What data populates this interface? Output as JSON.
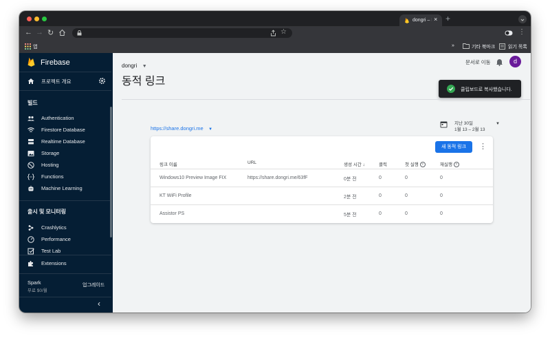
{
  "browser": {
    "tab_title": "dongri – Ⅰ",
    "tab_close": "×",
    "new_tab": "+",
    "bookmarks": {
      "apps": "앱",
      "more": "»",
      "other": "기타 북마크",
      "reading_list": "읽기 목록"
    }
  },
  "sidebar": {
    "brand": "Firebase",
    "overview": "프로젝트 개요",
    "section_build": "빌드",
    "build_items": [
      {
        "label": "Authentication"
      },
      {
        "label": "Firestore Database"
      },
      {
        "label": "Realtime Database"
      },
      {
        "label": "Storage"
      },
      {
        "label": "Hosting"
      },
      {
        "label": "Functions"
      },
      {
        "label": "Machine Learning"
      }
    ],
    "section_release": "출시 및 모니터링",
    "release_items": [
      {
        "label": "Crashlytics"
      },
      {
        "label": "Performance"
      },
      {
        "label": "Test Lab"
      }
    ],
    "extensions": "Extensions",
    "plan_name": "Spark",
    "plan_price": "무료 $0/월",
    "upgrade": "업그레이드",
    "collapse": "‹"
  },
  "header": {
    "project": "dongri",
    "title": "동적 링크",
    "docs_link": "문서로 이동",
    "avatar_letter": "d"
  },
  "toast": {
    "message": "클립보드로 복사했습니다."
  },
  "filters": {
    "domain": "https://share.dongri.me",
    "date_range": "지난 30일",
    "date_detail": "1월 13 – 2월 13"
  },
  "table": {
    "new_button": "새 동적 링크",
    "headers": {
      "name": "링크 이름",
      "url": "URL",
      "created": "생성 시간",
      "sort_arrow": "↓",
      "clicks": "클릭",
      "first_opens": "첫 실행",
      "reopens": "재실행"
    },
    "rows": [
      {
        "name": "Windows10 Preview Image FIX",
        "url": "https://share.dongri.me/63fF",
        "created": "0분 전",
        "clicks": "0",
        "first_opens": "0",
        "reopens": "0"
      },
      {
        "name": "KT WiFi Profile",
        "url": "",
        "created": "2분 전",
        "clicks": "0",
        "first_opens": "0",
        "reopens": "0"
      },
      {
        "name": "Assistor PS",
        "url": "",
        "created": "5분 전",
        "clicks": "0",
        "first_opens": "0",
        "reopens": "0"
      }
    ]
  },
  "colors": {
    "sidebar_bg": "#051e34",
    "accent": "#1a73e8",
    "firebase_yellow": "#ffca28",
    "toast_check": "#34a853",
    "avatar": "#6a1b9a"
  }
}
